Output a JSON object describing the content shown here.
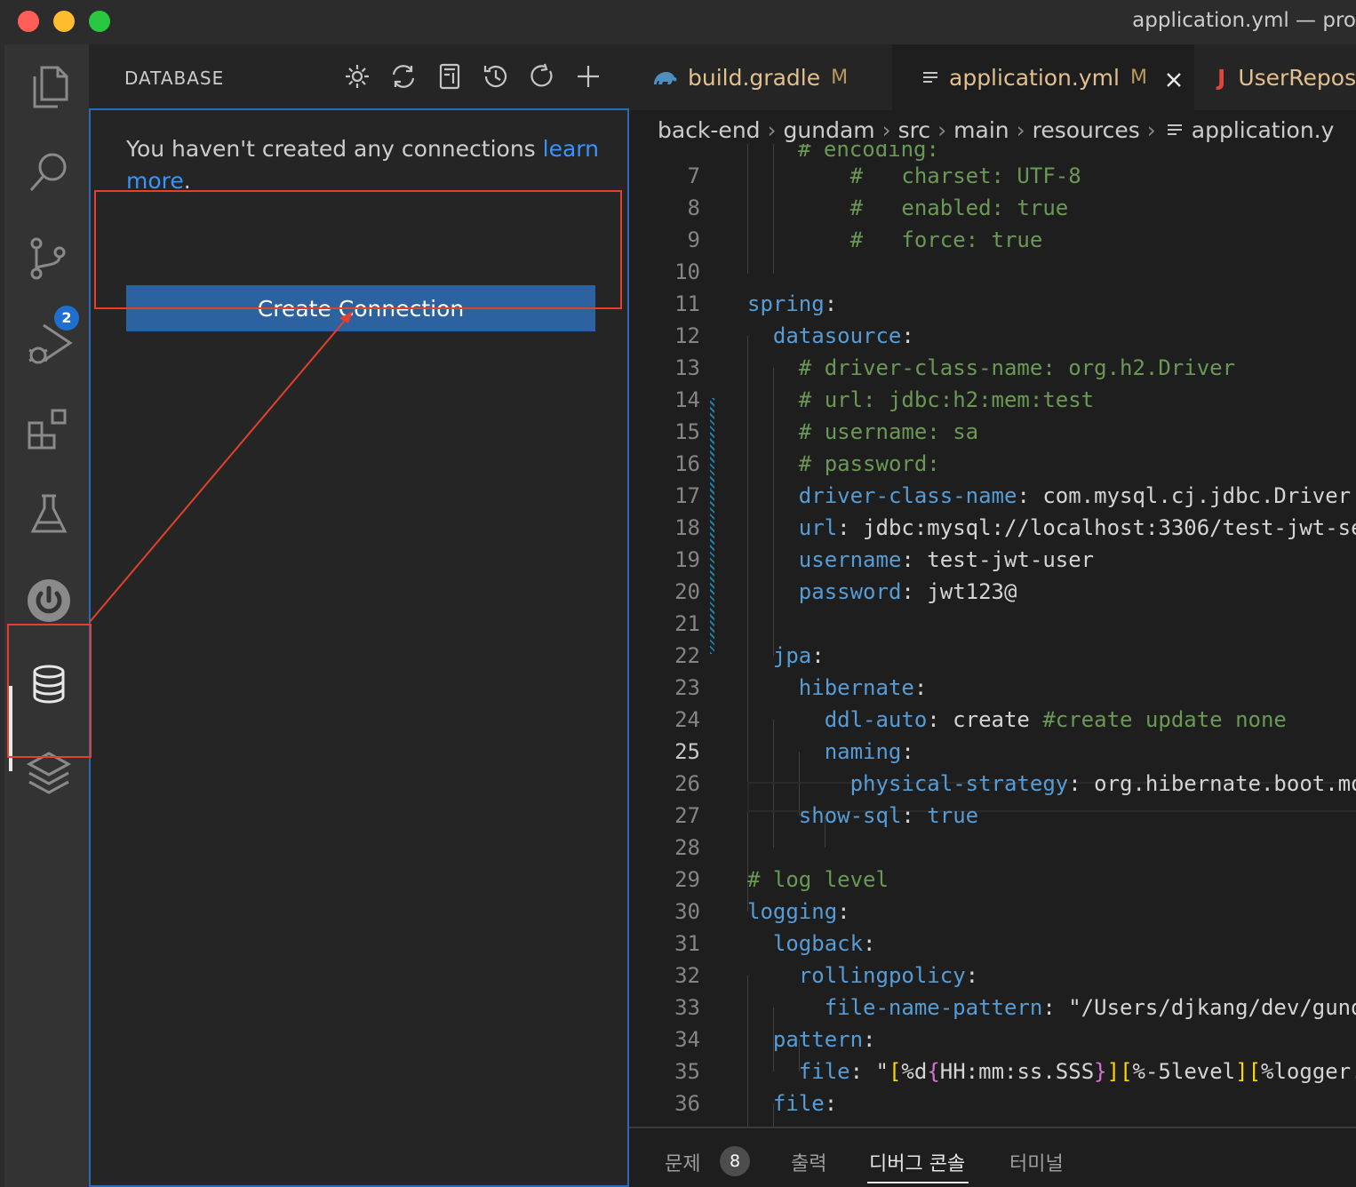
{
  "window": {
    "title": "application.yml — pro"
  },
  "activity_bar": {
    "scm_badge": "2"
  },
  "sidebar": {
    "title": "DATABASE",
    "message": "You haven't created any connections ",
    "learn_more": "learn more",
    "period": ".",
    "create_button": "Create Connection"
  },
  "tabs": [
    {
      "label": "build.gradle",
      "status": "M"
    },
    {
      "label": "application.yml",
      "status": "M"
    },
    {
      "label": "UserRepos"
    }
  ],
  "breadcrumb": [
    "back-end",
    "gundam",
    "src",
    "main",
    "resources",
    "application.y"
  ],
  "editor": {
    "line_numbers": [
      "7",
      "8",
      "9",
      "10",
      "11",
      "12",
      "13",
      "14",
      "15",
      "16",
      "17",
      "18",
      "19",
      "20",
      "21",
      "22",
      "23",
      "24",
      "25",
      "26",
      "27",
      "28",
      "29",
      "30",
      "31",
      "32",
      "33",
      "34",
      "35",
      "36"
    ],
    "current_line": "25",
    "partial_top": "# encoding:"
  },
  "panel": {
    "problems": "문제",
    "problems_count": "8",
    "output": "출력",
    "debug_console": "디버그 콘솔",
    "terminal": "터미널"
  },
  "colors": {
    "accent": "#2d62a0",
    "highlight": "#e4402b",
    "link": "#3794ff"
  }
}
